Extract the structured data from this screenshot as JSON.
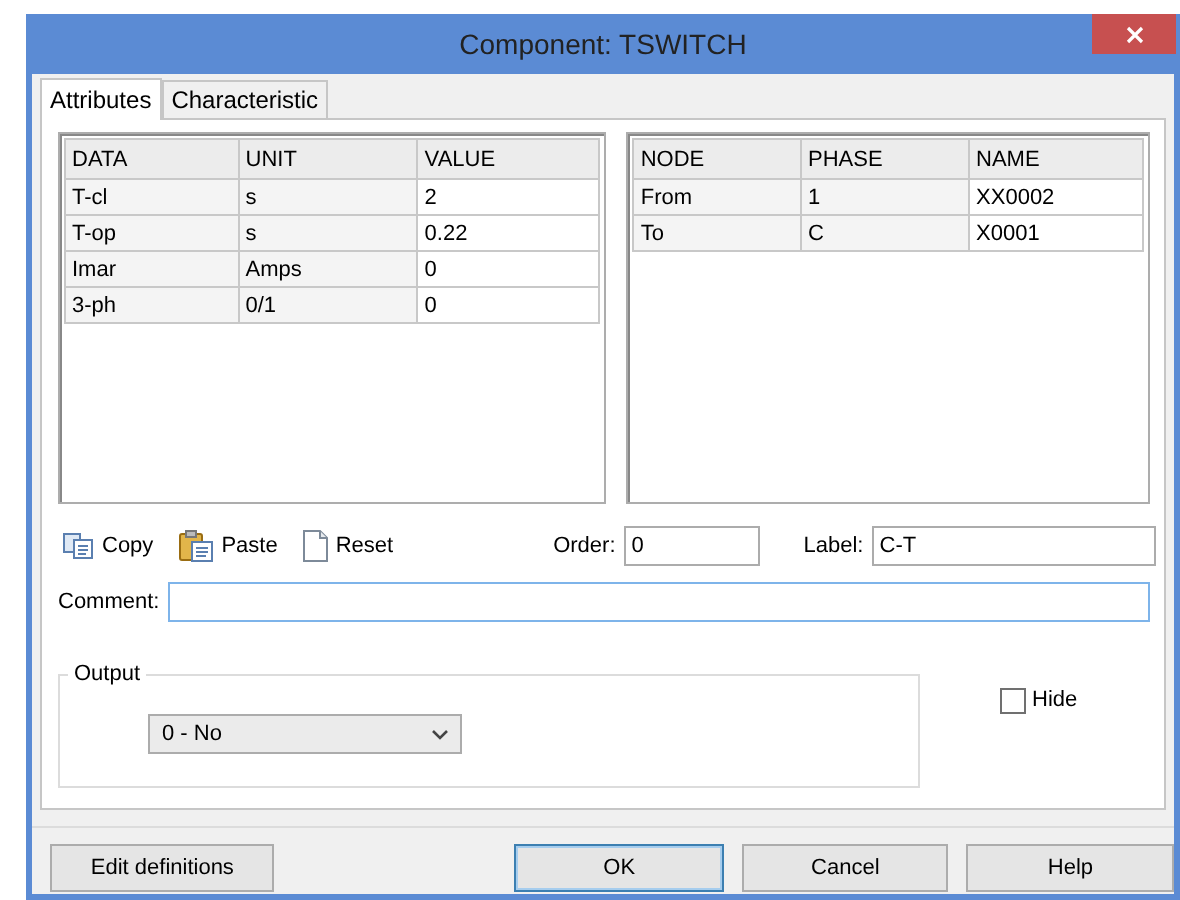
{
  "window": {
    "title": "Component: TSWITCH"
  },
  "tabs": [
    {
      "label": "Attributes",
      "selected": true
    },
    {
      "label": "Characteristic",
      "selected": false
    }
  ],
  "attributes_table": {
    "columns": [
      "DATA",
      "UNIT",
      "VALUE"
    ],
    "rows": [
      [
        "T-cl",
        "s",
        "2"
      ],
      [
        "T-op",
        "s",
        "0.22"
      ],
      [
        "Imar",
        "Amps",
        "0"
      ],
      [
        "3-ph",
        "0/1",
        "0"
      ]
    ]
  },
  "nodes_table": {
    "columns": [
      "NODE",
      "PHASE",
      "NAME"
    ],
    "rows": [
      [
        "From",
        "1",
        "XX0002"
      ],
      [
        "To",
        "C",
        "X0001"
      ]
    ]
  },
  "toolbar": [
    {
      "kind": "copy",
      "label": "Copy"
    },
    {
      "kind": "paste",
      "label": "Paste"
    },
    {
      "kind": "reset",
      "label": "Reset"
    }
  ],
  "order": {
    "label": "Order:",
    "value": "0"
  },
  "label_field": {
    "label": "Label:",
    "value": "C-T"
  },
  "comment": {
    "label": "Comment:"
  },
  "output": {
    "title": "Output",
    "value": "0 - No"
  },
  "hide": {
    "label": "Hide",
    "checked": false
  },
  "buttons": [
    {
      "label": "Edit definitions",
      "focused": false
    },
    {
      "label": "OK",
      "focused": true
    },
    {
      "label": "Cancel",
      "focused": false
    },
    {
      "label": "Help",
      "focused": false
    }
  ]
}
